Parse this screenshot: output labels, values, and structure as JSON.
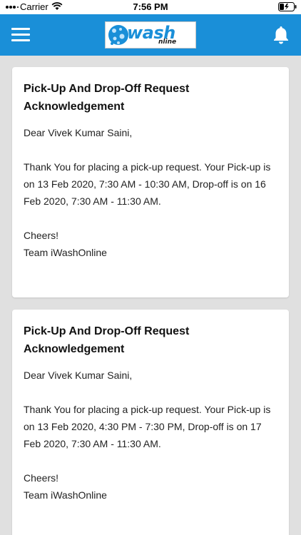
{
  "status_bar": {
    "carrier": "Carrier",
    "time": "7:56 PM"
  },
  "header": {
    "logo_text": "wash",
    "logo_sub": "nline",
    "menu_icon": "hamburger-menu-icon",
    "bell_icon": "bell-icon",
    "accent_color": "#1a8fd8"
  },
  "notifications": [
    {
      "title": "Pick-Up And Drop-Off Request Acknowledgement",
      "greeting": "Dear Vivek Kumar Saini,",
      "body": "Thank You for placing a pick-up request. Your Pick-up is on 13 Feb 2020, 7:30 AM - 10:30 AM, Drop-off is on 16 Feb 2020, 7:30 AM - 11:30 AM.",
      "closing_line1": "Cheers!",
      "closing_line2": "Team iWashOnline"
    },
    {
      "title": "Pick-Up And Drop-Off Request Acknowledgement",
      "greeting": "Dear Vivek Kumar Saini,",
      "body": "Thank You for placing a pick-up request. Your Pick-up is on 13 Feb 2020, 4:30 PM - 7:30 PM, Drop-off is on 17 Feb 2020, 7:30 AM - 11:30 AM.",
      "closing_line1": "Cheers!",
      "closing_line2": "Team iWashOnline"
    }
  ]
}
